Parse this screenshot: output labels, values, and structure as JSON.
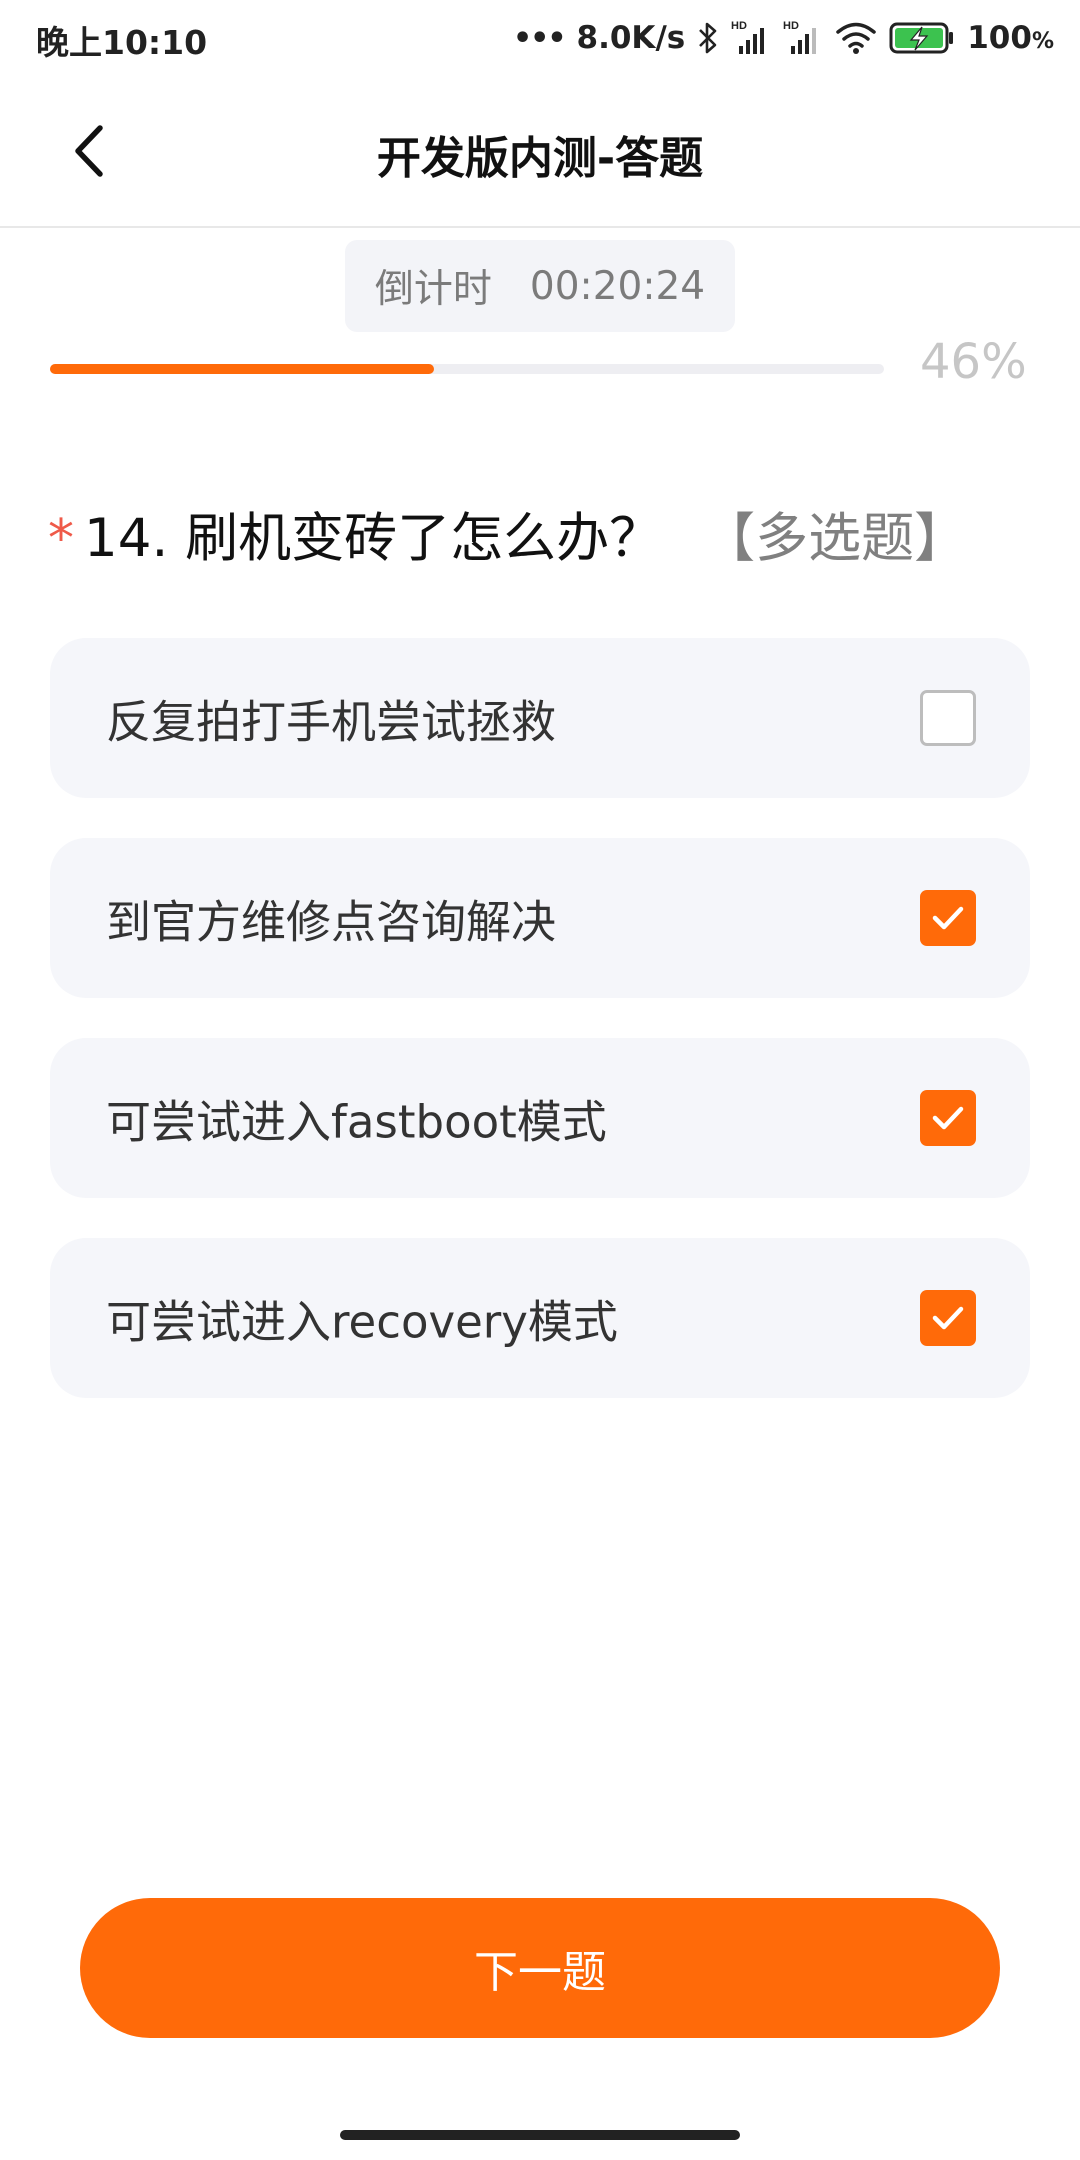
{
  "status_bar": {
    "time": "晚上10:10",
    "dots": "•••",
    "net_speed": "8.0K/s",
    "battery_percent": "100",
    "battery_unit": "%",
    "icons": [
      "bluetooth-icon",
      "signal-hd-icon",
      "signal-hd-icon",
      "wifi-icon",
      "battery-charging-icon"
    ]
  },
  "header": {
    "title": "开发版内测-答题",
    "back_icon": "chevron-left-icon"
  },
  "countdown": {
    "label": "倒计时",
    "time": "00:20:24"
  },
  "progress": {
    "value": 0.46,
    "label": "46%"
  },
  "question": {
    "required_mark": "*",
    "text": "14. 刷机变砖了怎么办？",
    "type": "【多选题】"
  },
  "options": [
    {
      "label": "反复拍打手机尝试拯救",
      "checked": false
    },
    {
      "label": "到官方维修点咨询解决",
      "checked": true
    },
    {
      "label": "可尝试进入fastboot模式",
      "checked": true
    },
    {
      "label": "可尝试进入recovery模式",
      "checked": true
    }
  ],
  "next_button": {
    "label": "下一题"
  },
  "colors": {
    "accent": "#ff6a09",
    "required": "#ef5a49",
    "option_bg": "#f5f6fa"
  }
}
